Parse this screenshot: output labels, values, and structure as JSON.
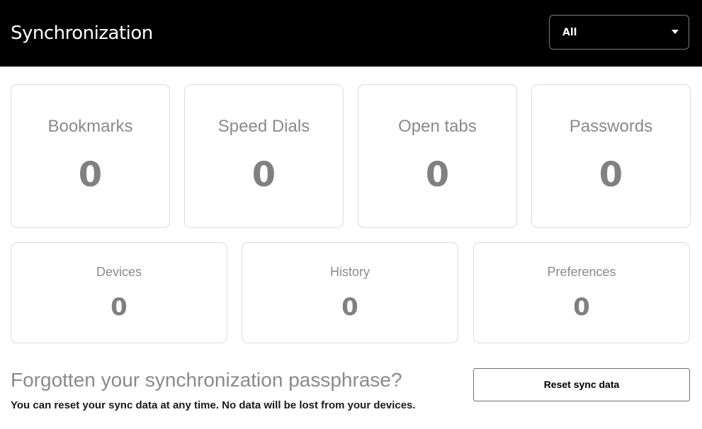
{
  "header": {
    "title": "Synchronization",
    "filter": {
      "selected": "All"
    }
  },
  "cards": [
    {
      "label": "Bookmarks",
      "count": "0"
    },
    {
      "label": "Speed Dials",
      "count": "0"
    },
    {
      "label": "Open tabs",
      "count": "0"
    },
    {
      "label": "Passwords",
      "count": "0"
    },
    {
      "label": "Devices",
      "count": "0"
    },
    {
      "label": "History",
      "count": "0"
    },
    {
      "label": "Preferences",
      "count": "0"
    }
  ],
  "forgot": {
    "title": "Forgotten your synchronization passphrase?",
    "text": "You can reset your sync data at any time. No data will be lost from your devices.",
    "reset_label": "Reset sync data"
  }
}
